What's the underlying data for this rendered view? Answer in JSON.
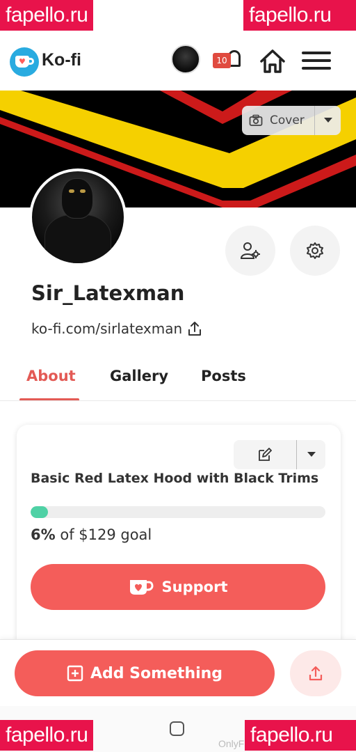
{
  "watermarks": {
    "top_left": "fapello.ru",
    "top_right": "fapello.ru",
    "bottom_left": "fapello.ru",
    "bottom_right": "fapello.ru",
    "bottom_faded": "OnlyF"
  },
  "header": {
    "logo_text": "Ko-fi",
    "notification_count": "10",
    "icons": [
      "kofi-logo-icon",
      "user-avatar",
      "bell-icon",
      "home-icon",
      "hamburger-menu-icon"
    ]
  },
  "cover": {
    "button_label": "Cover",
    "colors": {
      "yellow": "#f5d000",
      "red": "#cc1a1a",
      "black": "#000000"
    }
  },
  "profile": {
    "username": "Sir_Latexman",
    "url": "ko-fi.com/sirlatexman"
  },
  "tabs": [
    {
      "label": "About",
      "active": true
    },
    {
      "label": "Gallery",
      "active": false
    },
    {
      "label": "Posts",
      "active": false
    }
  ],
  "goal": {
    "title": "Basic Red Latex Hood with Black Trims",
    "percent_label": "6%",
    "goal_text": "of $129 goal",
    "progress_fraction": 0.06,
    "support_label": "Support"
  },
  "bottom": {
    "add_label": "Add Something"
  },
  "colors": {
    "accent": "#f45d5a",
    "accent_text": "#e35a55",
    "progress": "#4fd1a5",
    "logo_blue": "#29abe0"
  }
}
